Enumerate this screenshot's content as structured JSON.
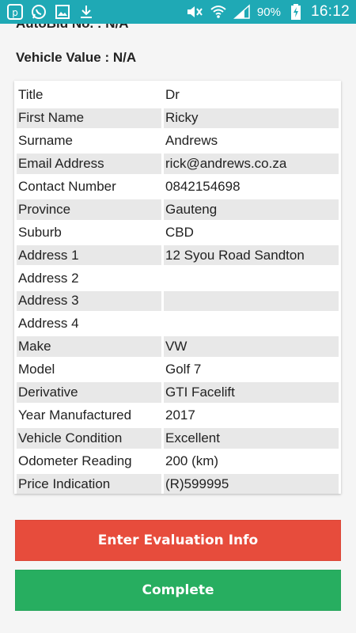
{
  "status_bar": {
    "battery": "90%",
    "time": "16:12"
  },
  "header": {
    "autobid": "AutoBid No. : N/A",
    "vehicle_value": "Vehicle Value : N/A"
  },
  "details": [
    {
      "label": "Title",
      "value": "Dr"
    },
    {
      "label": "First Name",
      "value": "Ricky"
    },
    {
      "label": "Surname",
      "value": "Andrews"
    },
    {
      "label": "Email Address",
      "value": "rick@andrews.co.za"
    },
    {
      "label": "Contact Number",
      "value": "0842154698"
    },
    {
      "label": "Province",
      "value": "Gauteng"
    },
    {
      "label": "Suburb",
      "value": "CBD"
    },
    {
      "label": "Address 1",
      "value": "12 Syou Road Sandton"
    },
    {
      "label": "Address 2",
      "value": ""
    },
    {
      "label": "Address 3",
      "value": ""
    },
    {
      "label": "Address 4",
      "value": ""
    },
    {
      "label": "Make",
      "value": "VW"
    },
    {
      "label": "Model",
      "value": "Golf 7"
    },
    {
      "label": "Derivative",
      "value": "GTI Facelift"
    },
    {
      "label": "Year Manufactured",
      "value": "2017"
    },
    {
      "label": "Vehicle Condition",
      "value": "Excellent"
    },
    {
      "label": "Odometer Reading",
      "value": "200 (km)"
    },
    {
      "label": "Price Indication",
      "value": "(R)599995"
    }
  ],
  "buttons": {
    "evaluation": "Enter Evaluation Info",
    "complete": "Complete"
  },
  "colors": {
    "status_bar": "#1fa9b5",
    "evaluation_button": "#e74c3c",
    "complete_button": "#27ae60"
  }
}
